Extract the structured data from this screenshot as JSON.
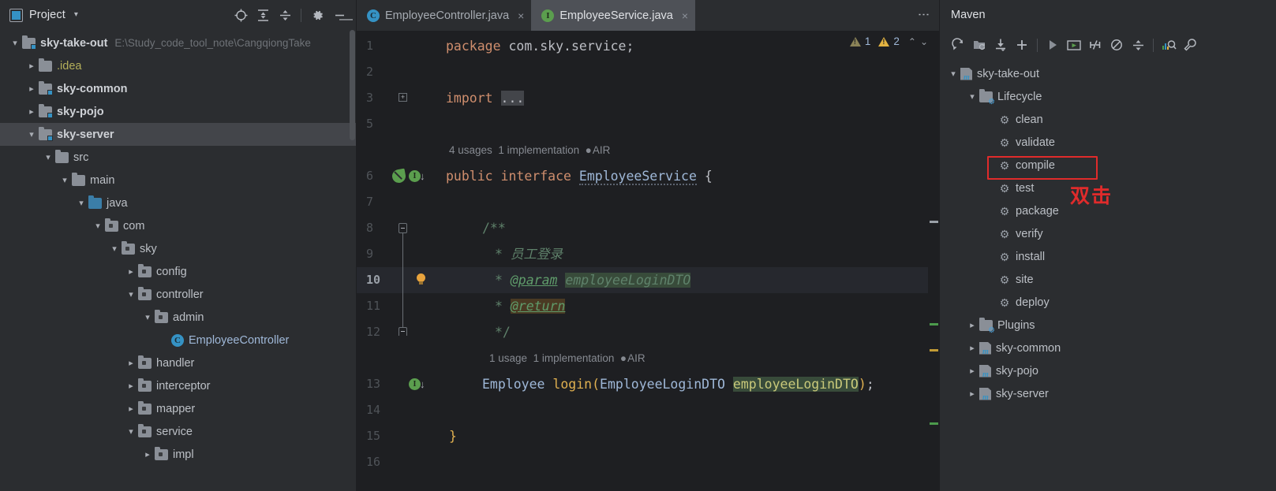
{
  "project_panel": {
    "title": "Project",
    "caret": "▾",
    "tools": [
      {
        "name": "select-opened-file-icon",
        "label": "Select Opened File"
      },
      {
        "name": "expand-all-icon",
        "label": "Expand All"
      },
      {
        "name": "collapse-all-icon",
        "label": "Collapse All"
      },
      {
        "name": "settings-gear-icon",
        "label": "Settings"
      },
      {
        "name": "hide-icon",
        "label": "Hide"
      }
    ],
    "tree": [
      {
        "label": "sky-take-out",
        "path": "E:\\Study_code_tool_note\\CangqiongTake",
        "indent": 0,
        "arrow": "expanded",
        "icon": "module",
        "bold": true
      },
      {
        "label": ".idea",
        "indent": 1,
        "arrow": "collapsed",
        "icon": "folder",
        "style": "yellowish"
      },
      {
        "label": "sky-common",
        "indent": 1,
        "arrow": "collapsed",
        "icon": "module",
        "bold": true
      },
      {
        "label": "sky-pojo",
        "indent": 1,
        "arrow": "collapsed",
        "icon": "module",
        "bold": true
      },
      {
        "label": "sky-server",
        "indent": 1,
        "arrow": "expanded",
        "icon": "module",
        "bold": true,
        "selected": true
      },
      {
        "label": "src",
        "indent": 2,
        "arrow": "expanded",
        "icon": "folder"
      },
      {
        "label": "main",
        "indent": 3,
        "arrow": "expanded",
        "icon": "folder"
      },
      {
        "label": "java",
        "indent": 4,
        "arrow": "expanded",
        "icon": "folder-source"
      },
      {
        "label": "com",
        "indent": 5,
        "arrow": "expanded",
        "icon": "package"
      },
      {
        "label": "sky",
        "indent": 6,
        "arrow": "expanded",
        "icon": "package"
      },
      {
        "label": "config",
        "indent": 7,
        "arrow": "collapsed",
        "icon": "package"
      },
      {
        "label": "controller",
        "indent": 7,
        "arrow": "expanded",
        "icon": "package"
      },
      {
        "label": "admin",
        "indent": 8,
        "arrow": "expanded",
        "icon": "package"
      },
      {
        "label": "EmployeeController",
        "indent": 9,
        "arrow": "none",
        "icon": "class",
        "style": "classname"
      },
      {
        "label": "handler",
        "indent": 7,
        "arrow": "collapsed",
        "icon": "package"
      },
      {
        "label": "interceptor",
        "indent": 7,
        "arrow": "collapsed",
        "icon": "package"
      },
      {
        "label": "mapper",
        "indent": 7,
        "arrow": "collapsed",
        "icon": "package"
      },
      {
        "label": "service",
        "indent": 7,
        "arrow": "expanded",
        "icon": "package"
      },
      {
        "label": "impl",
        "indent": 8,
        "arrow": "collapsed",
        "icon": "package"
      }
    ]
  },
  "editor": {
    "tabs": [
      {
        "label": "EmployeeController.java",
        "icon": "class-icon",
        "icon_letter": "C",
        "active": false,
        "close": "×"
      },
      {
        "label": "EmployeeService.java",
        "icon": "interface-icon",
        "icon_letter": "I",
        "active": true,
        "close": "×"
      }
    ],
    "inspections": {
      "weak_warning_count": "1",
      "warning_count": "2",
      "chevron_up": "⌃",
      "chevron_down": "⌄"
    },
    "line_numbers": [
      "1",
      "2",
      "3",
      "5",
      "6",
      "7",
      "8",
      "9",
      "10",
      "11",
      "12",
      "13",
      "14",
      "15",
      "16"
    ],
    "current_line": "10",
    "code": {
      "l1_package_kw": "package",
      "l1_package_name": "com.sky.service;",
      "l3_import_kw": "import",
      "l3_import_fold": "...",
      "hint_interface": {
        "usages": "4 usages",
        "implementations": "1 implementation",
        "author": "AIR"
      },
      "l6_public": "public",
      "l6_interface": "interface",
      "l6_name": "EmployeeService",
      "l6_brace": "{",
      "l8_javadoc_open": "/**",
      "l9_star": "*",
      "l9_desc": "员工登录",
      "l10_star": "*",
      "l10_tag": "@param",
      "l10_param": "employeeLoginDTO",
      "l11_star": "*",
      "l11_tag": "@return",
      "l12_javadoc_close": "*/",
      "hint_method": {
        "usages": "1 usage",
        "implementations": "1 implementation",
        "author": "AIR"
      },
      "l13_rettype": "Employee",
      "l13_method": "login",
      "l13_open": "(",
      "l13_argtype": "EmployeeLoginDTO",
      "l13_argname": "employeeLoginDTO",
      "l13_close": ")",
      "l13_semi": ";",
      "l15_brace": "}"
    }
  },
  "maven_panel": {
    "title": "Maven",
    "more_dots": "⋮",
    "tools": [
      {
        "name": "reload-all-projects-icon",
        "label": "Reload All Maven Projects"
      },
      {
        "name": "generate-sources-icon",
        "label": "Generate Sources and Update Folders"
      },
      {
        "name": "download-sources-icon",
        "label": "Download Sources"
      },
      {
        "name": "add-maven-project-icon",
        "label": "Add Maven Project"
      },
      {
        "name": "run-icon",
        "label": "Run"
      },
      {
        "name": "execute-goal-icon",
        "label": "Execute Maven Goal"
      },
      {
        "name": "skip-tests-icon",
        "label": "Toggle Skip Tests Mode"
      },
      {
        "name": "offline-mode-icon",
        "label": "Toggle Offline Mode"
      },
      {
        "name": "collapse-all-icon",
        "label": "Collapse All"
      },
      {
        "name": "profiles-icon",
        "label": "Show Dependency Analyzer"
      },
      {
        "name": "settings-wrench-icon",
        "label": "Maven Settings"
      }
    ],
    "tree": [
      {
        "label": "sky-take-out",
        "indent": 0,
        "arrow": "expanded",
        "icon": "maven-module"
      },
      {
        "label": "Lifecycle",
        "indent": 1,
        "arrow": "expanded",
        "icon": "lifecycle-folder"
      },
      {
        "label": "clean",
        "indent": 2,
        "arrow": "none",
        "icon": "goal-gear"
      },
      {
        "label": "validate",
        "indent": 2,
        "arrow": "none",
        "icon": "goal-gear"
      },
      {
        "label": "compile",
        "indent": 2,
        "arrow": "none",
        "icon": "goal-gear",
        "highlighted": true
      },
      {
        "label": "test",
        "indent": 2,
        "arrow": "none",
        "icon": "goal-gear"
      },
      {
        "label": "package",
        "indent": 2,
        "arrow": "none",
        "icon": "goal-gear"
      },
      {
        "label": "verify",
        "indent": 2,
        "arrow": "none",
        "icon": "goal-gear"
      },
      {
        "label": "install",
        "indent": 2,
        "arrow": "none",
        "icon": "goal-gear"
      },
      {
        "label": "site",
        "indent": 2,
        "arrow": "none",
        "icon": "goal-gear"
      },
      {
        "label": "deploy",
        "indent": 2,
        "arrow": "none",
        "icon": "goal-gear"
      },
      {
        "label": "Plugins",
        "indent": 1,
        "arrow": "collapsed",
        "icon": "lifecycle-folder"
      },
      {
        "label": "sky-common",
        "indent": 1,
        "arrow": "collapsed",
        "icon": "maven-module"
      },
      {
        "label": "sky-pojo",
        "indent": 1,
        "arrow": "collapsed",
        "icon": "maven-module"
      },
      {
        "label": "sky-server",
        "indent": 1,
        "arrow": "collapsed",
        "icon": "maven-module"
      }
    ]
  },
  "annotation": {
    "text": "双击",
    "color": "#e02b2b",
    "target": "compile"
  }
}
